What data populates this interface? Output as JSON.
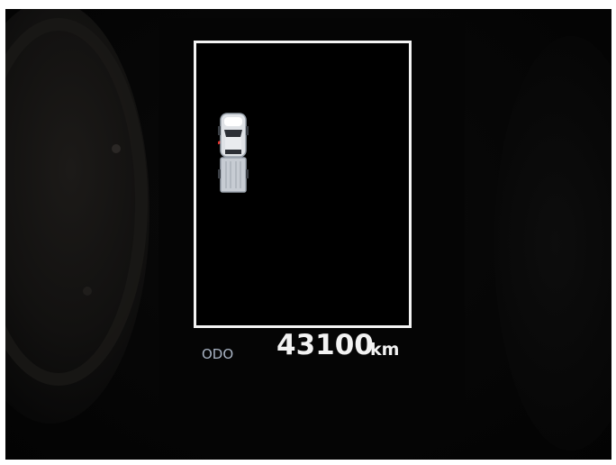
{
  "odometer": {
    "label": "ODO",
    "value": "43100",
    "unit": "km"
  },
  "vehicle_status": {
    "icon": "pickup-truck-top-view-icon",
    "open_door": "front-left",
    "open_door_color": "#e0302a"
  },
  "colors": {
    "frame": "#f4f4f4",
    "odo_label": "#a9b4c4",
    "odo_value": "#f2f2f2"
  }
}
